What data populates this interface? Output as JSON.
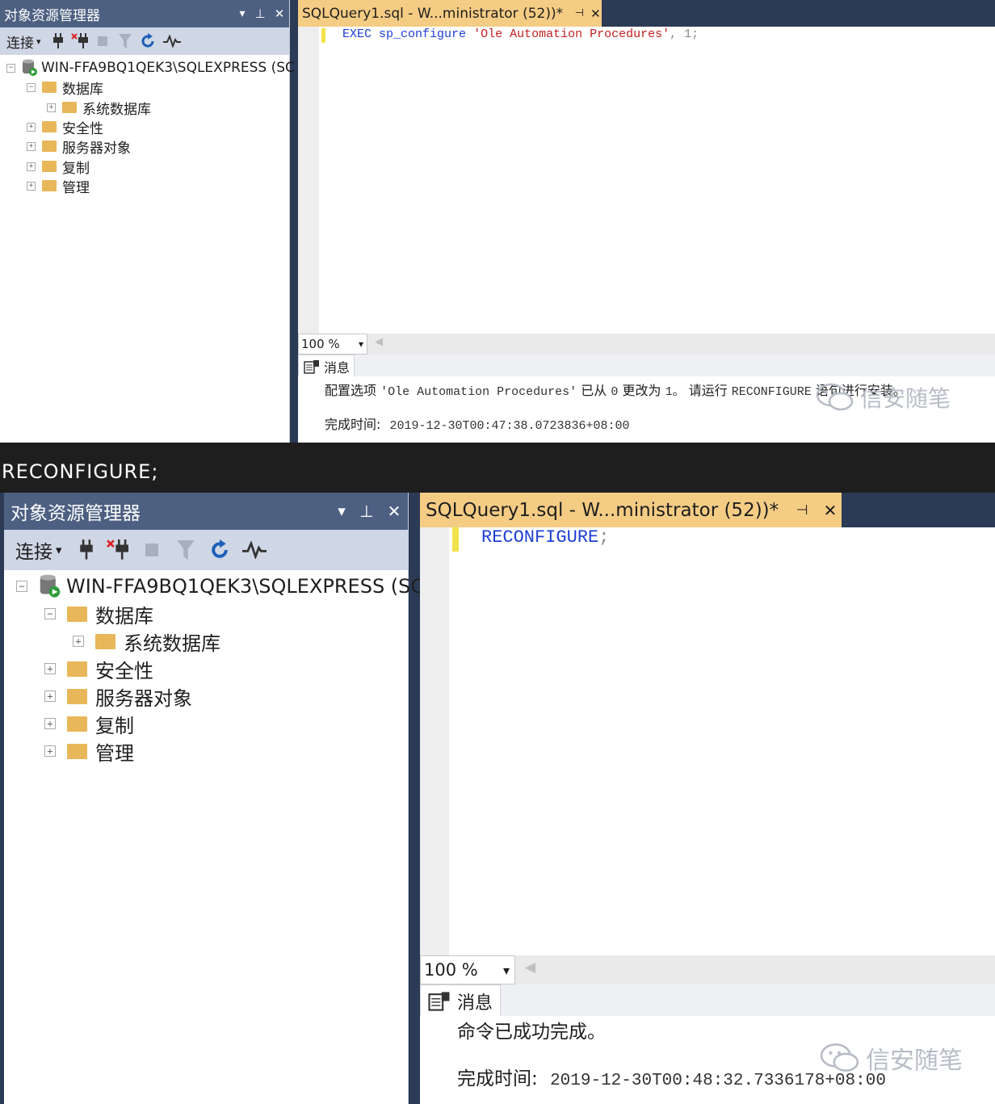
{
  "caption": "RECONFIGURE;",
  "explorer": {
    "title": "对象资源管理器",
    "connect_label": "连接",
    "server": "WIN-FFA9BQ1QEK3\\SQLEXPRESS (SC",
    "databases": "数据库",
    "system_databases": "系统数据库",
    "security": "安全性",
    "server_objects": "服务器对象",
    "replication": "复制",
    "management": "管理",
    "expand_minus": "−",
    "expand_plus": "+"
  },
  "icons": {
    "dropdown": "▾",
    "pin": "⊥",
    "close": "✕",
    "tab_pin": "⊣",
    "connect": "plug-icon",
    "disconnect": "disconnect-icon",
    "stop": "stop-icon",
    "filter": "filter-icon",
    "refresh": "refresh-icon",
    "activity": "activity-monitor-icon",
    "messages": "messages-icon",
    "wechat": "wechat-icon"
  },
  "colors": {
    "title_bar": "#4d6082",
    "active_tab": "#f5cc84",
    "keyword": "#1f3fd6",
    "string": "#c02020"
  },
  "screenshot1": {
    "tab_title": "SQLQuery1.sql - W...ministrator (52))*",
    "code": {
      "kw1": "EXEC",
      "proc": "sp_configure",
      "str": "'Ole Automation Procedures'",
      "rest": ", 1;"
    },
    "zoom": "100 %",
    "messages_tab": "消息",
    "message_line1_a": "配置选项",
    "message_line1_b": "'Ole Automation Procedures'",
    "message_line1_c": "已从",
    "message_line1_d": "0",
    "message_line1_e": "更改为",
    "message_line1_f": "1。",
    "message_line1_g": "请运行",
    "message_line1_h": "RECONFIGURE",
    "message_line1_i": "语句进行安装。",
    "completion_label": "完成时间:",
    "completion_time": "2019-12-30T00:47:38.0723836+08:00",
    "watermark": "信安随笔"
  },
  "screenshot2": {
    "tab_title": "SQLQuery1.sql - W...ministrator (52))*",
    "code": {
      "kw1": "RECONFIGURE",
      "rest": ";"
    },
    "zoom": "100 %",
    "messages_tab": "消息",
    "message_line1": "命令已成功完成。",
    "completion_label": "完成时间:",
    "completion_time": "2019-12-30T00:48:32.7336178+08:00",
    "watermark": "信安随笔"
  }
}
